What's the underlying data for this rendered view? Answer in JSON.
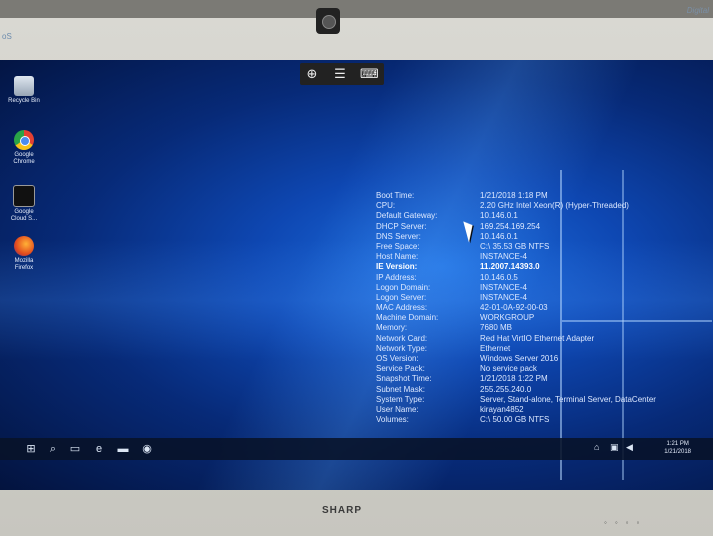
{
  "monitor": {
    "brand": "SHARP",
    "corner_left": "oS",
    "corner_right": "Digital"
  },
  "remote_toolbar": {
    "icons": [
      "zoom-in-icon",
      "menu-icon",
      "keyboard-icon"
    ]
  },
  "desktop_icons": [
    {
      "label": "Recycle Bin",
      "icon": "recycle-bin-icon"
    },
    {
      "label": "Google Chrome",
      "icon": "chrome-icon"
    },
    {
      "label": "Google Cloud S...",
      "icon": "cloud-shell-icon"
    },
    {
      "label": "Mozilla Firefox",
      "icon": "firefox-icon"
    }
  ],
  "bginfo": [
    {
      "key": "Boot Time:",
      "value": "1/21/2018 1:18 PM"
    },
    {
      "key": "CPU:",
      "value": "2.20 GHz Intel Xeon(R) (Hyper-Threaded)"
    },
    {
      "key": "Default Gateway:",
      "value": "10.146.0.1"
    },
    {
      "key": "DHCP Server:",
      "value": "169.254.169.254"
    },
    {
      "key": "DNS Server:",
      "value": "10.146.0.1"
    },
    {
      "key": "Free Space:",
      "value": "C:\\ 35.53 GB NTFS"
    },
    {
      "key": "Host Name:",
      "value": "INSTANCE-4"
    },
    {
      "key": "IE Version:",
      "value": "11.2007.14393.0"
    },
    {
      "key": "IP Address:",
      "value": "10.146.0.5"
    },
    {
      "key": "Logon Domain:",
      "value": "INSTANCE-4"
    },
    {
      "key": "Logon Server:",
      "value": "INSTANCE-4"
    },
    {
      "key": "MAC Address:",
      "value": "42-01-0A-92-00-03"
    },
    {
      "key": "Machine Domain:",
      "value": "WORKGROUP"
    },
    {
      "key": "Memory:",
      "value": "7680 MB"
    },
    {
      "key": "Network Card:",
      "value": "Red Hat VirtIO Ethernet Adapter"
    },
    {
      "key": "Network Type:",
      "value": "Ethernet"
    },
    {
      "key": "OS Version:",
      "value": "Windows Server 2016"
    },
    {
      "key": "Service Pack:",
      "value": "No service pack"
    },
    {
      "key": "Snapshot Time:",
      "value": "1/21/2018 1:22 PM"
    },
    {
      "key": "Subnet Mask:",
      "value": "255.255.240.0"
    },
    {
      "key": "System Type:",
      "value": "Server, Stand-alone, Terminal Server, DataCenter"
    },
    {
      "key": "User Name:",
      "value": "kirayan4852"
    },
    {
      "key": "Volumes:",
      "value": "C:\\ 50.00 GB NTFS"
    }
  ],
  "taskbar": {
    "icons": [
      "start-icon",
      "search-icon",
      "task-view-icon",
      "edge-icon",
      "file-explorer-icon",
      "chrome-icon"
    ],
    "clock_time": "1:21 PM",
    "clock_date": "1/21/2018"
  }
}
